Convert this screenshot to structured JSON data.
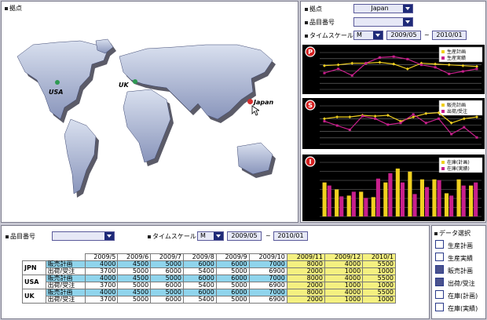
{
  "map_panel": {
    "title": "拠点",
    "markers": [
      {
        "label": "USA",
        "color": "#2e9a52"
      },
      {
        "label": "UK",
        "color": "#2e9a52"
      },
      {
        "label": "Japan",
        "color": "#d83030"
      }
    ]
  },
  "filter_panel": {
    "location_label": "拠点",
    "location_value": "Japan",
    "item_label": "品目番号",
    "item_value": "",
    "timescale_label": "タイムスケール",
    "timescale_value": "M",
    "date_from": "2009/05",
    "tilde": "~",
    "date_to": "2010/01"
  },
  "charts": {
    "p": {
      "badge": "P",
      "legend": [
        "生産計画",
        "生産実績"
      ]
    },
    "s": {
      "badge": "S",
      "legend": [
        "販売計画",
        "出荷/受注"
      ]
    },
    "i": {
      "badge": "I",
      "legend": [
        "在庫(計画)",
        "在庫(実績)"
      ]
    }
  },
  "colors": {
    "plan": "#f0d020",
    "actual": "#c8208c",
    "map": "#aebad6",
    "navy": "#1e2a78"
  },
  "chart_data": [
    {
      "type": "line",
      "title": "P",
      "series": [
        {
          "name": "生産計画",
          "values": [
            59,
            60,
            62,
            62,
            63,
            61,
            55,
            62,
            61,
            60,
            59,
            58
          ]
        },
        {
          "name": "生産実績",
          "values": [
            50,
            55,
            47,
            62,
            69,
            70,
            67,
            60,
            57,
            49,
            52,
            55
          ]
        }
      ]
    },
    {
      "type": "line",
      "title": "S",
      "series": [
        {
          "name": "販売計画",
          "values": [
            60,
            62,
            62,
            64,
            63,
            64,
            57,
            62,
            66,
            67,
            55,
            60,
            62
          ]
        },
        {
          "name": "出荷/受注",
          "values": [
            57,
            52,
            47,
            63,
            60,
            53,
            55,
            65,
            55,
            60,
            42,
            50,
            38
          ]
        }
      ]
    },
    {
      "type": "bar",
      "title": "I",
      "series": [
        {
          "name": "在庫(計画)",
          "values": [
            44,
            35,
            27,
            32,
            25,
            44,
            62,
            58,
            48,
            48,
            30,
            48,
            40
          ]
        },
        {
          "name": "在庫(実績)",
          "values": [
            40,
            26,
            32,
            24,
            49,
            56,
            44,
            29,
            38,
            47,
            27,
            40,
            44
          ]
        }
      ]
    }
  ],
  "bottom_panel": {
    "item_label": "品目番号",
    "item_value": "",
    "timescale_label": "タイムスケール",
    "timescale_value": "M",
    "date_from": "2009/05",
    "tilde": "~",
    "date_to": "2010/01"
  },
  "table": {
    "months": [
      "2009/5",
      "2009/6",
      "2009/7",
      "2009/8",
      "2009/9",
      "2009/10",
      "2009/11",
      "2009/12",
      "2010/1"
    ],
    "countries": [
      {
        "name": "JPN",
        "rows": [
          {
            "label": "販売計画",
            "values": [
              "4000",
              "4500",
              "5000",
              "6000",
              "6000",
              "7000",
              "8000",
              "4000",
              "5500"
            ]
          },
          {
            "label": "出荷/受注",
            "values": [
              "3700",
              "5000",
              "6000",
              "5400",
              "5000",
              "6900",
              "2000",
              "1000",
              "1000"
            ]
          }
        ]
      },
      {
        "name": "USA",
        "rows": [
          {
            "label": "販売計画",
            "values": [
              "4000",
              "4500",
              "5000",
              "6000",
              "6000",
              "7000",
              "8000",
              "4000",
              "5500"
            ]
          },
          {
            "label": "出荷/受注",
            "values": [
              "3700",
              "5000",
              "6000",
              "5400",
              "5000",
              "6900",
              "2000",
              "1000",
              "1000"
            ]
          }
        ]
      },
      {
        "name": "UK",
        "rows": [
          {
            "label": "販売計画",
            "values": [
              "4000",
              "4500",
              "5000",
              "6000",
              "6000",
              "7000",
              "8000",
              "4000",
              "5500"
            ]
          },
          {
            "label": "出荷/受注",
            "values": [
              "3700",
              "5000",
              "6000",
              "5400",
              "5000",
              "6900",
              "2000",
              "1000",
              "1000"
            ]
          }
        ]
      }
    ]
  },
  "data_select": {
    "title": "データ選択",
    "items": [
      {
        "label": "生産計画",
        "checked": false
      },
      {
        "label": "生産実績",
        "checked": false
      },
      {
        "label": "販売計画",
        "checked": true
      },
      {
        "label": "出荷/受注",
        "checked": true
      },
      {
        "label": "在庫(計画)",
        "checked": false
      },
      {
        "label": "在庫(実績)",
        "checked": false
      }
    ]
  }
}
